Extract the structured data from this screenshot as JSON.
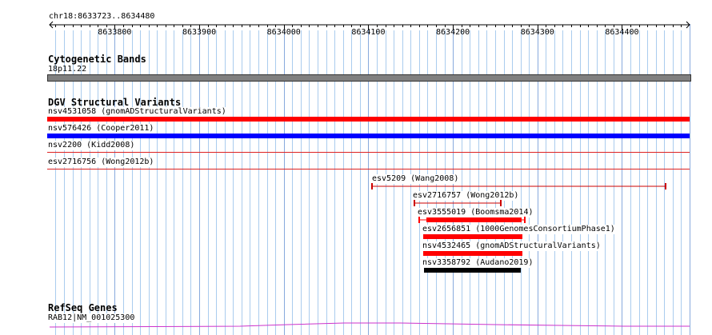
{
  "ruler": {
    "location": "chr18:8633723..8634480",
    "ticks": [
      "8633800",
      "8633900",
      "8634000",
      "8634100",
      "8634200",
      "8634300",
      "8634400"
    ]
  },
  "cytoband": {
    "title": "Cytogenetic Bands",
    "band": "18p11.22"
  },
  "dgv": {
    "title": "DGV Structural Variants",
    "items": [
      {
        "label": "nsv4531058 (gnomADStructuralVariants)",
        "color": "#ff0000",
        "style": "thick"
      },
      {
        "label": "nsv576426 (Cooper2011)",
        "color": "#0000ff",
        "style": "thick"
      },
      {
        "label": "nsv2200 (Kidd2008)",
        "color": "#dd2222",
        "style": "line"
      },
      {
        "label": "esv2716756 (Wong2012b)",
        "color": "#dd2222",
        "style": "line"
      },
      {
        "label": "esv5209 (Wang2008)",
        "color": "#cc0000",
        "style": "interval"
      },
      {
        "label": "esv2716757 (Wong2012b)",
        "color": "#cc0000",
        "style": "interval"
      },
      {
        "label": "esv3555019 (Boomsma2014)",
        "color": "#ff0000",
        "style": "interval-thick"
      },
      {
        "label": "esv2656851 (1000GenomesConsortiumPhase1)",
        "color": "#ff0000",
        "style": "thick"
      },
      {
        "label": "nsv4532465 (gnomADStructuralVariants)",
        "color": "#ff0000",
        "style": "thick"
      },
      {
        "label": "nsv3358792 (Audano2019)",
        "color": "#000000",
        "style": "thick"
      }
    ]
  },
  "refseq": {
    "title": "RefSeq Genes",
    "gene": "RAB12|NM_001025300",
    "color": "#cc33cc"
  },
  "colors": {
    "grid": "#aaccee",
    "cytoband": "#808080"
  }
}
